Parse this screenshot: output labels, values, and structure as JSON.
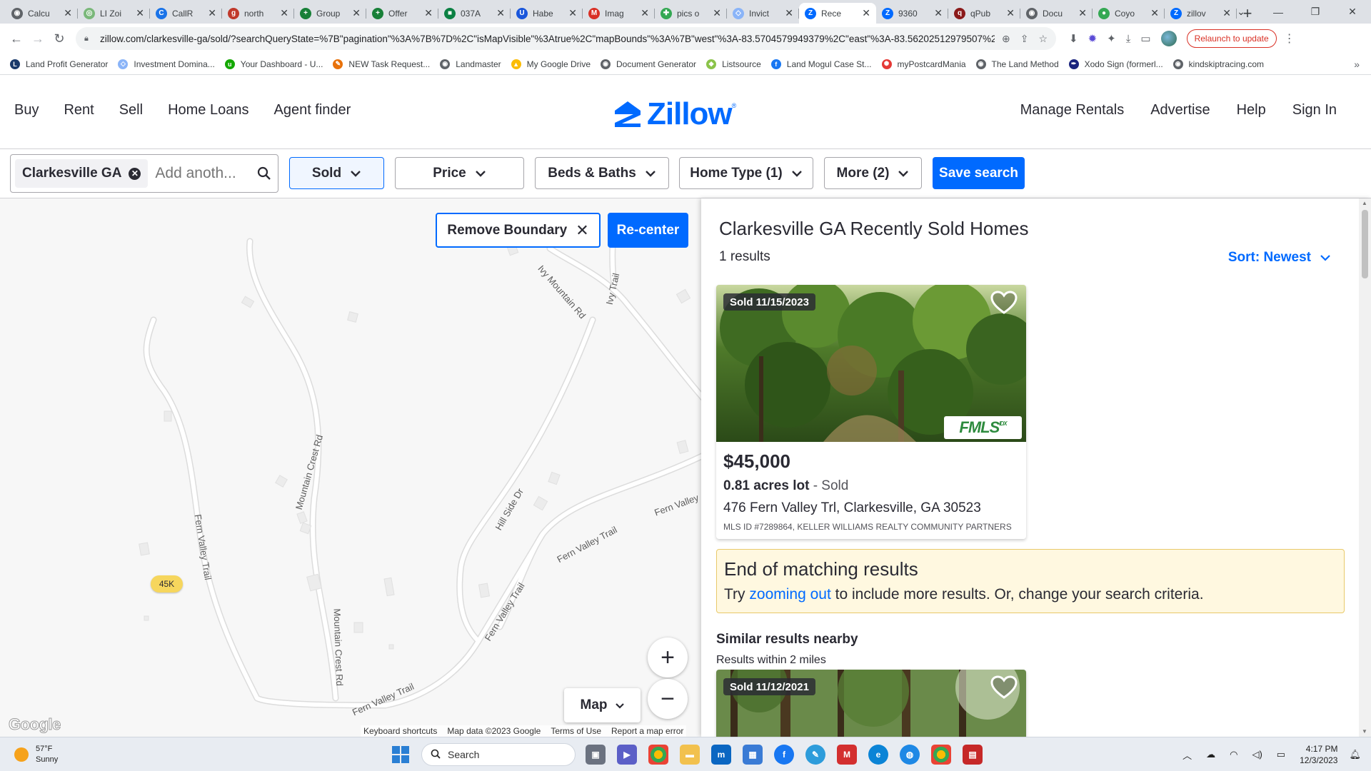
{
  "browser": {
    "tabs": [
      {
        "title": "Calcu",
        "color": "#5f6368",
        "glyph": "◉"
      },
      {
        "title": "LI Zoi",
        "color": "#7ab87a",
        "glyph": "◎"
      },
      {
        "title": "CallR",
        "color": "#1a73e8",
        "glyph": "C"
      },
      {
        "title": "north",
        "color": "#c0392b",
        "glyph": "g"
      },
      {
        "title": "Group",
        "color": "#188038",
        "glyph": "+"
      },
      {
        "title": "Offer",
        "color": "#188038",
        "glyph": "+"
      },
      {
        "title": "037A",
        "color": "#0b8043",
        "glyph": "■"
      },
      {
        "title": "Habe",
        "color": "#1a56db",
        "glyph": "U"
      },
      {
        "title": "Imag",
        "color": "#d93025",
        "glyph": "M"
      },
      {
        "title": "pics o",
        "color": "#34a853",
        "glyph": "✚"
      },
      {
        "title": "Invict",
        "color": "#8ab4f8",
        "glyph": "◇"
      },
      {
        "title": "Rece",
        "color": "#006aff",
        "glyph": "Z",
        "active": true
      },
      {
        "title": "9360",
        "color": "#006aff",
        "glyph": "Z"
      },
      {
        "title": "qPub",
        "color": "#8b1a1a",
        "glyph": "q"
      },
      {
        "title": "Docu",
        "color": "#5f6368",
        "glyph": "◉"
      },
      {
        "title": "Coyo",
        "color": "#34a853",
        "glyph": "●"
      },
      {
        "title": "zillov",
        "color": "#006aff",
        "glyph": "Z"
      }
    ],
    "url": "zillow.com/clarkesville-ga/sold/?searchQueryState=%7B\"pagination\"%3A%7B%7D%2C\"isMapVisible\"%3Atrue%2C\"mapBounds\"%3A%7B\"west\"%3A-83.5704579949379%2C\"east\"%3A-83.56202512979507%2C\"sou...",
    "relaunch_label": "Relaunch to update",
    "bookmarks": [
      {
        "label": "Land Profit Generator",
        "color": "#1a3a6b",
        "glyph": "L"
      },
      {
        "label": "Investment Domina...",
        "color": "#8ab4f8",
        "glyph": "◇"
      },
      {
        "label": "Your Dashboard - U...",
        "color": "#14a800",
        "glyph": "u"
      },
      {
        "label": "NEW Task Request...",
        "color": "#e8710a",
        "glyph": "✎"
      },
      {
        "label": "Landmaster",
        "color": "#5f6368",
        "glyph": "◉"
      },
      {
        "label": "My Google Drive",
        "color": "#fbbc04",
        "glyph": "▲"
      },
      {
        "label": "Document Generator",
        "color": "#5f6368",
        "glyph": "◉"
      },
      {
        "label": "Listsource",
        "color": "#8bc34a",
        "glyph": "◆"
      },
      {
        "label": "Land Mogul Case St...",
        "color": "#1877f2",
        "glyph": "f"
      },
      {
        "label": "myPostcardMania",
        "color": "#e53935",
        "glyph": "✺"
      },
      {
        "label": "The Land Method",
        "color": "#5f6368",
        "glyph": "◉"
      },
      {
        "label": "Xodo Sign (formerl...",
        "color": "#1a237e",
        "glyph": "✒"
      },
      {
        "label": "kindskiptracing.com",
        "color": "#5f6368",
        "glyph": "◉"
      }
    ]
  },
  "zillow": {
    "brand_color": "#006aff",
    "logo_text": "Zillow",
    "logo_reg": "®",
    "nav_left": [
      "Buy",
      "Rent",
      "Sell",
      "Home Loans",
      "Agent finder"
    ],
    "nav_right": [
      "Manage Rentals",
      "Advertise",
      "Help",
      "Sign In"
    ],
    "search": {
      "chip": "Clarkesville GA",
      "placeholder": "Add anoth..."
    },
    "filters": {
      "sold": "Sold",
      "price": "Price",
      "beds_baths": "Beds & Baths",
      "home_type": "Home Type (1)",
      "more": "More (2)",
      "save": "Save search"
    },
    "map": {
      "remove_boundary": "Remove Boundary",
      "recenter": "Re-center",
      "price_pin": "45K",
      "zoom_in": "+",
      "zoom_out": "−",
      "map_type": "Map",
      "google_logo": "Google",
      "footer": [
        "Keyboard shortcuts",
        "Map data ©2023 Google",
        "Terms of Use",
        "Report a map error"
      ],
      "road_labels": {
        "ivy_mountain": "Ivy Mountain Rd",
        "ivy_trail": "Ivy Trail",
        "mountain_crest_1": "Mountain Crest Rd",
        "mountain_crest_2": "Mountain Crest Rd",
        "fern_valley_trail_1": "Fern Valley Trail",
        "fern_valley_trail_2": "Fern Valley Trail",
        "fern_valley_trail_3": "Fern Valley Trail",
        "fern_valley_trail_4": "Fern Valley Trail",
        "fern_valley_trail_5": "Fern Valley",
        "hill_side": "Hill Side Dr"
      }
    },
    "results": {
      "title": "Clarkesville GA Recently Sold Homes",
      "count": "1 results",
      "sort": "Sort: Newest",
      "listing": {
        "sold_tag": "Sold 11/15/2023",
        "price": "$45,000",
        "facts": "0.81 acres lot",
        "status": " - Sold",
        "address": "476 Fern Valley Trl, Clarkesville, GA 30523",
        "mls": "MLS ID #7289864, KELLER WILLIAMS REALTY COMMUNITY PARTNERS",
        "badge": "FMLS",
        "badge_sup": "IDX"
      },
      "end": {
        "heading": "End of matching results",
        "prefix": "Try ",
        "link": "zooming out",
        "suffix": " to include more results. Or, change your search criteria."
      },
      "similar_heading": "Similar results nearby",
      "similar_sub": "Results within 2 miles",
      "similar_listing": {
        "sold_tag": "Sold 11/12/2021"
      }
    }
  },
  "taskbar": {
    "weather_temp": "57°F",
    "weather_desc": "Sunny",
    "search_placeholder": "Search",
    "time": "4:17 PM",
    "date": "12/3/2023"
  }
}
